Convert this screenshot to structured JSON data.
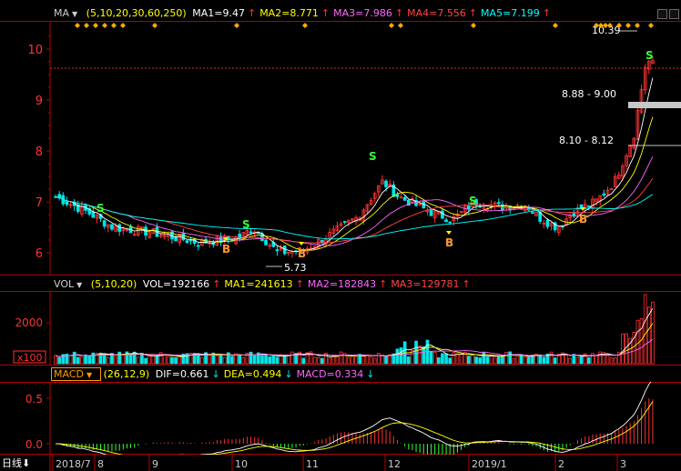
{
  "header": {
    "indicator": "MA",
    "params": "(5,10,20,30,60,250)",
    "ma_items": [
      {
        "label": "MA1=9.47",
        "arrow": "↑",
        "color": "#ffffff"
      },
      {
        "label": "MA2=8.771",
        "arrow": "↑",
        "color": "#ffff00"
      },
      {
        "label": "MA3=7.986",
        "arrow": "↑",
        "color": "#ff66ff"
      },
      {
        "label": "MA4=7.556",
        "arrow": "↑",
        "color": "#ff4444"
      },
      {
        "label": "MA5=7.199",
        "arrow": "↑",
        "color": "#00ffff"
      }
    ]
  },
  "price_panel": {
    "y_ticks": [
      "10",
      "9",
      "8",
      "7",
      "6"
    ],
    "annotations": {
      "high": "10.39",
      "low": "5.73",
      "zone_upper": "8.88 - 9.00",
      "zone_lower": "8.10 - 8.12"
    },
    "signal_buy": "B",
    "signal_sell": "S"
  },
  "vol_panel": {
    "indicator": "VOL",
    "params": "(5,10,20)",
    "items": [
      {
        "label": "VOL=192166",
        "arrow": "↑",
        "color": "#ffffff"
      },
      {
        "label": "MA1=241613",
        "arrow": "↑",
        "color": "#ffff00"
      },
      {
        "label": "MA2=182843",
        "arrow": "↑",
        "color": "#ff66ff"
      },
      {
        "label": "MA3=129781",
        "arrow": "↑",
        "color": "#ff4444"
      }
    ],
    "y_tick": "2000",
    "unit": "x100"
  },
  "macd_panel": {
    "indicator": "MACD",
    "params": "(26,12,9)",
    "items": [
      {
        "label": "DIF=0.661",
        "arrow": "↓",
        "color": "#ffffff"
      },
      {
        "label": "DEA=0.494",
        "arrow": "↓",
        "color": "#ffff00"
      },
      {
        "label": "MACD=0.334",
        "arrow": "↓",
        "color": "#ff66ff"
      }
    ],
    "y_ticks": [
      "0.5",
      "0.0"
    ]
  },
  "x_axis": {
    "period": "日线",
    "labels": [
      "2018/7",
      "8",
      "9",
      "10",
      "11",
      "12",
      "2019/1",
      "2",
      "3"
    ]
  },
  "colors": {
    "up": "#ff3232",
    "down": "#00e5e5",
    "axis": "#b40000",
    "text": "#cccccc"
  }
}
